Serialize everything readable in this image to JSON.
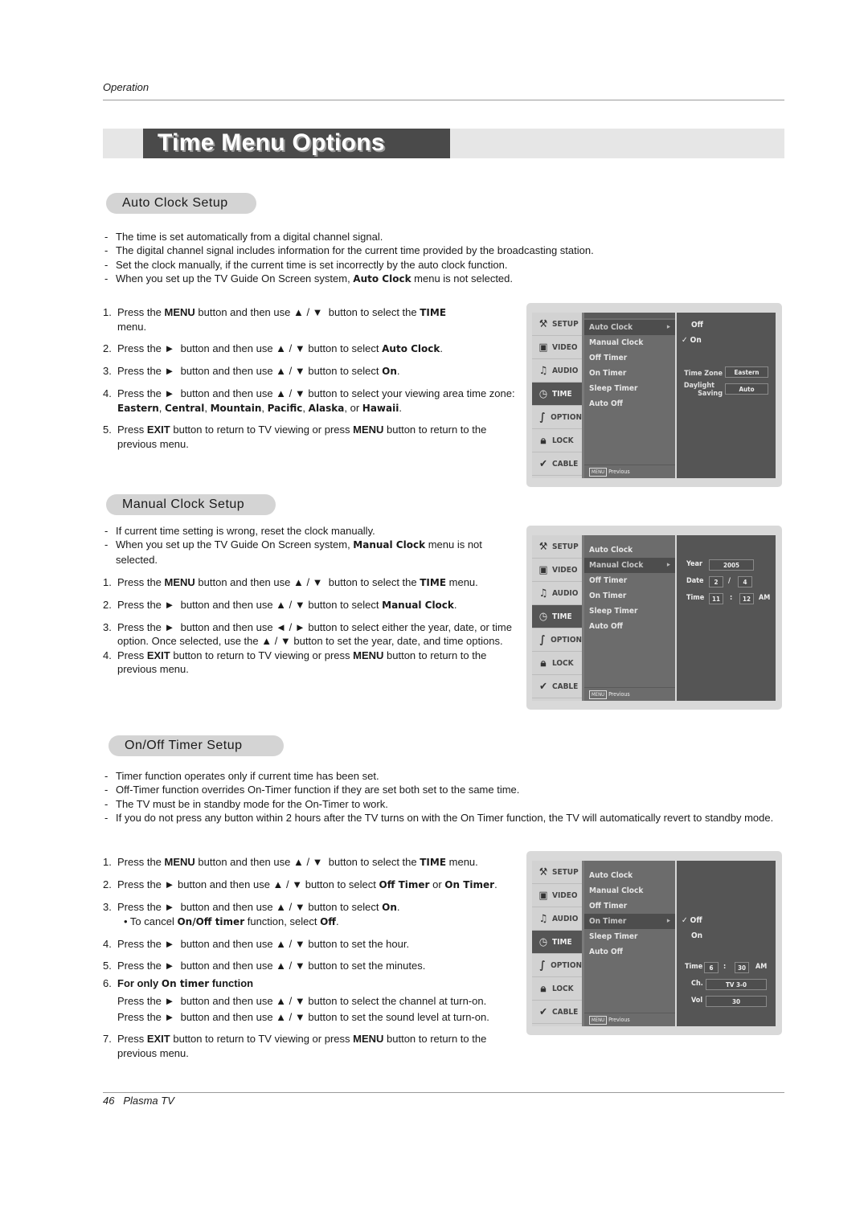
{
  "page": {
    "running_head": "Operation",
    "title": "Time Menu Options",
    "footer": {
      "page_number": "46",
      "product": "Plasma TV"
    }
  },
  "auto_clock": {
    "heading": "Auto Clock Setup",
    "notes": [
      "The time is set automatically from a digital channel signal.",
      "The digital channel signal includes information for the current time provided by the broadcasting station.",
      "Set the clock manually, if the current time is set incorrectly by the auto clock function.",
      "When you set up the TV Guide On Screen system, Auto Clock menu is not selected."
    ],
    "steps": [
      "Press the MENU button and then use ▲ / ▼ button to select the TIME menu.",
      "Press the ► button and then use ▲ / ▼ button to select Auto Clock.",
      "Press the ► button and then use ▲ / ▼ button to select On.",
      "Press the ► button and then use ▲ / ▼ button to select your viewing area time zone: Eastern, Central, Mountain, Pacific, Alaska, or Hawaii.",
      "Press EXIT button to return to TV viewing or press MENU button to return to the previous menu."
    ]
  },
  "manual_clock": {
    "heading": "Manual Clock Setup",
    "notes": [
      "If current time setting is wrong, reset the clock manually.",
      "When you set up the TV Guide On Screen system, Manual Clock menu is not selected."
    ],
    "steps": [
      "Press the MENU button and then use ▲ / ▼ button to select the TIME menu.",
      "Press the ► button and then use ▲ / ▼ button to select Manual Clock.",
      "Press the ► button and then use ◄ / ► button to select either the year, date, or time option. Once selected, use the ▲ / ▼ button to set the year, date, and time options.",
      "Press EXIT button to return to TV viewing or press MENU button to return to the previous menu."
    ]
  },
  "onoff_timer": {
    "heading": "On/Off Timer Setup",
    "notes": [
      "Timer function operates only if current time has been set.",
      "Off-Timer function overrides On-Timer function if they are set both set to the same time.",
      "The TV must be in standby mode for the On-Timer to work.",
      "If you do not press any button within 2 hours after the TV turns on with the On Timer function, the TV will automatically revert to standby mode."
    ],
    "steps": [
      "Press the MENU button and then use ▲ / ▼ button to select the TIME menu.",
      "Press the ► button and then use ▲ / ▼ button to select Off Timer or On Timer.",
      "Press the ► button and then use ▲ / ▼ button to select On.",
      "Press the ► button and then use ▲ / ▼ button to set the hour.",
      "Press the ► button and then use ▲ / ▼ button to set the minutes.",
      "For only On timer function",
      "Press EXIT button to return to TV viewing or press MENU button to return to the previous menu."
    ],
    "step3_sub": "• To cancel On/Off timer function, select Off.",
    "step6_lines": [
      "Press the ► button and then use ▲ / ▼ button to select the channel at turn-on.",
      "Press the ► button and then use ▲ / ▼ button to set the sound level at turn-on."
    ]
  },
  "tv_menu": {
    "tabs": [
      "SETUP",
      "VIDEO",
      "AUDIO",
      "TIME",
      "OPTION",
      "LOCK",
      "CABLE"
    ],
    "active_tab": "TIME",
    "items": [
      "Auto Clock",
      "Manual Clock",
      "Off Timer",
      "On Timer",
      "Sleep Timer",
      "Auto Off"
    ],
    "footer_button": "MENU",
    "footer_label": "Previous",
    "screens": {
      "auto_clock": {
        "selected_item": "Auto Clock",
        "options": [
          "Off",
          "✓ On"
        ],
        "time_zone_label": "Time Zone",
        "time_zone_value": "Eastern",
        "daylight_label_1": "Daylight",
        "daylight_label_2": "Saving",
        "daylight_value": "Auto"
      },
      "manual_clock": {
        "selected_item": "Manual Clock",
        "year_label": "Year",
        "year": "2005",
        "date_label": "Date",
        "month": "2",
        "date_sep": "/",
        "day": "4",
        "time_label": "Time",
        "hour": "11",
        "time_sep": ":",
        "minute": "12",
        "ampm": "AM"
      },
      "on_timer": {
        "selected_item": "On Timer",
        "options": [
          "✓ Off",
          "On"
        ],
        "time_label": "Time",
        "hour": "6",
        "time_sep": ":",
        "minute": "30",
        "ampm": "AM",
        "ch_label": "Ch.",
        "ch_value": "TV 3-0",
        "vol_label": "Vol",
        "vol_value": "30"
      }
    }
  }
}
